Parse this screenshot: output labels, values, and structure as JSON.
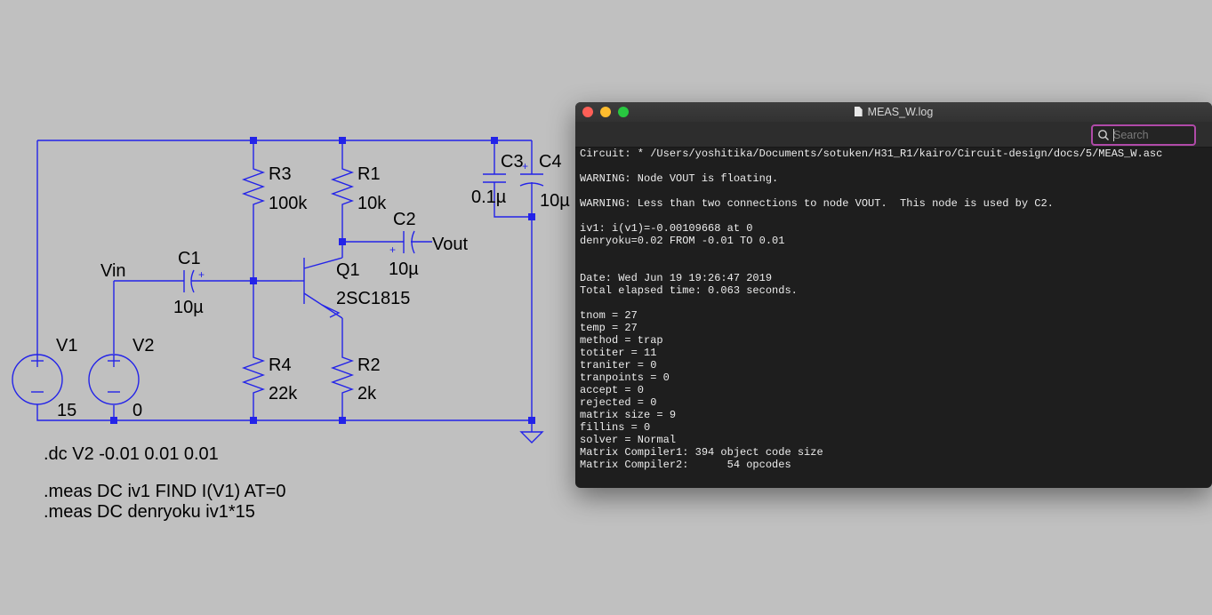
{
  "schematic": {
    "refs": {
      "R3": "R3",
      "R3_value": "100k",
      "R1": "R1",
      "R1_value": "10k",
      "C2": "C2",
      "C2_value": "10µ",
      "C3": "C3",
      "C3_value": "0.1µ",
      "C4": "C4",
      "C4_value": "10µ",
      "C1": "C1",
      "C1_value": "10µ",
      "Q1": "Q1",
      "Q1_value": "2SC1815",
      "R4": "R4",
      "R4_value": "22k",
      "R2": "R2",
      "R2_value": "2k",
      "V1": "V1",
      "V1_value": "15",
      "V2": "V2",
      "V2_value": "0"
    },
    "nets": {
      "vin": "Vin",
      "vout": "Vout"
    },
    "plus_sign": "+",
    "directives": {
      "dc": ".dc V2 -0.01 0.01 0.01",
      "meas1": ".meas DC iv1 FIND I(V1) AT=0",
      "meas2": ".meas DC denryoku iv1*15"
    },
    "wire_color": "#2323e8"
  },
  "log_window": {
    "title": "MEAS_W.log",
    "search": {
      "placeholder": "Search",
      "value": ""
    },
    "lines": [
      "Circuit: * /Users/yoshitika/Documents/sotuken/H31_R1/kairo/Circuit-design/docs/5/MEAS_W.asc",
      "",
      "WARNING: Node VOUT is floating.",
      "",
      "WARNING: Less than two connections to node VOUT.  This node is used by C2.",
      "",
      "iv1: i(v1)=-0.00109668 at 0",
      "denryoku=0.02 FROM -0.01 TO 0.01",
      "",
      "",
      "Date: Wed Jun 19 19:26:47 2019",
      "Total elapsed time: 0.063 seconds.",
      "",
      "tnom = 27",
      "temp = 27",
      "method = trap",
      "totiter = 11",
      "traniter = 0",
      "tranpoints = 0",
      "accept = 0",
      "rejected = 0",
      "matrix size = 9",
      "fillins = 0",
      "solver = Normal",
      "Matrix Compiler1: 394 object code size",
      "Matrix Compiler2:      54 opcodes"
    ],
    "traffic_lights": {
      "close": "#fe5f57",
      "minimize": "#febc2e",
      "maximize": "#28c840"
    },
    "search_focus_color": "#b04aa8"
  }
}
